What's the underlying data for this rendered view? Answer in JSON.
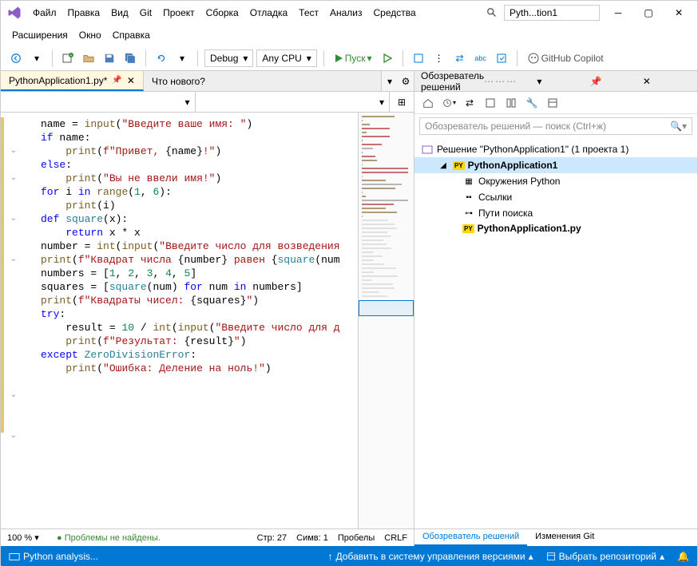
{
  "title_app": "Pyth...tion1",
  "menu": [
    "Файл",
    "Правка",
    "Вид",
    "Git",
    "Проект",
    "Сборка",
    "Отладка",
    "Тест",
    "Анализ",
    "Средства"
  ],
  "menu2": [
    "Расширения",
    "Окно",
    "Справка"
  ],
  "toolbar": {
    "config": "Debug",
    "platform": "Any CPU",
    "run": "Пуск",
    "copilot": "GitHub Copilot"
  },
  "tabs": {
    "active": "PythonApplication1.py*",
    "second": "Что нового?"
  },
  "code": [
    {
      "t": "name = ",
      "p": [
        [
          "fn",
          "input"
        ],
        [
          "op",
          "("
        ],
        [
          "str",
          "\"Введите ваше имя: \""
        ],
        [
          "op",
          ")"
        ]
      ]
    },
    {
      "t": ""
    },
    {
      "f": 1,
      "p": [
        [
          "kw",
          "if"
        ],
        [
          "op",
          " name:"
        ]
      ]
    },
    {
      "i": 1,
      "p": [
        [
          "fn",
          "print"
        ],
        [
          "op",
          "("
        ],
        [
          "str",
          "f\"Привет, "
        ],
        [
          "op",
          "{name}"
        ],
        [
          "str",
          "!\""
        ],
        [
          "op",
          ")"
        ]
      ]
    },
    {
      "f": 1,
      "p": [
        [
          "kw",
          "else"
        ],
        [
          "op",
          ":"
        ]
      ]
    },
    {
      "i": 1,
      "p": [
        [
          "fn",
          "print"
        ],
        [
          "op",
          "("
        ],
        [
          "str",
          "\"Вы не ввели имя!\""
        ],
        [
          "op",
          ")"
        ]
      ]
    },
    {
      "t": ""
    },
    {
      "f": 1,
      "p": [
        [
          "kw",
          "for"
        ],
        [
          "op",
          " i "
        ],
        [
          "kw",
          "in"
        ],
        [
          "op",
          " "
        ],
        [
          "fn",
          "range"
        ],
        [
          "op",
          "("
        ],
        [
          "num",
          "1"
        ],
        [
          "op",
          ", "
        ],
        [
          "num",
          "6"
        ],
        [
          "op",
          "):"
        ]
      ]
    },
    {
      "i": 1,
      "p": [
        [
          "fn",
          "print"
        ],
        [
          "op",
          "(i)"
        ]
      ]
    },
    {
      "t": ""
    },
    {
      "f": 1,
      "p": [
        [
          "kw",
          "def"
        ],
        [
          "op",
          " "
        ],
        [
          "fn2",
          "square"
        ],
        [
          "op",
          "(x):"
        ]
      ]
    },
    {
      "i": 1,
      "p": [
        [
          "kw",
          "return"
        ],
        [
          "op",
          " x * x"
        ]
      ]
    },
    {
      "t": ""
    },
    {
      "p": [
        [
          "op",
          "number = "
        ],
        [
          "fn",
          "int"
        ],
        [
          "op",
          "("
        ],
        [
          "fn",
          "input"
        ],
        [
          "op",
          "("
        ],
        [
          "str",
          "\"Введите число для возведения"
        ]
      ]
    },
    {
      "p": [
        [
          "fn",
          "print"
        ],
        [
          "op",
          "("
        ],
        [
          "str",
          "f\"Квадрат числа "
        ],
        [
          "op",
          "{number}"
        ],
        [
          "str",
          " равен "
        ],
        [
          "op",
          "{"
        ],
        [
          "fn2",
          "square"
        ],
        [
          "op",
          "(num"
        ]
      ]
    },
    {
      "t": ""
    },
    {
      "p": [
        [
          "op",
          "numbers = ["
        ],
        [
          "num",
          "1"
        ],
        [
          "op",
          ", "
        ],
        [
          "num",
          "2"
        ],
        [
          "op",
          ", "
        ],
        [
          "num",
          "3"
        ],
        [
          "op",
          ", "
        ],
        [
          "num",
          "4"
        ],
        [
          "op",
          ", "
        ],
        [
          "num",
          "5"
        ],
        [
          "op",
          "]"
        ]
      ]
    },
    {
      "p": [
        [
          "op",
          "squares = ["
        ],
        [
          "fn2",
          "square"
        ],
        [
          "op",
          "(num) "
        ],
        [
          "kw",
          "for"
        ],
        [
          "op",
          " num "
        ],
        [
          "kw",
          "in"
        ],
        [
          "op",
          " numbers]"
        ]
      ]
    },
    {
      "p": [
        [
          "fn",
          "print"
        ],
        [
          "op",
          "("
        ],
        [
          "str",
          "f\"Квадраты чисел: "
        ],
        [
          "op",
          "{squares}"
        ],
        [
          "str",
          "\""
        ],
        [
          "op",
          ")"
        ]
      ]
    },
    {
      "t": ""
    },
    {
      "f": 1,
      "p": [
        [
          "kw",
          "try"
        ],
        [
          "op",
          ":"
        ]
      ]
    },
    {
      "i": 1,
      "p": [
        [
          "op",
          "result = "
        ],
        [
          "num",
          "10"
        ],
        [
          "op",
          " / "
        ],
        [
          "fn",
          "int"
        ],
        [
          "op",
          "("
        ],
        [
          "fn",
          "input"
        ],
        [
          "op",
          "("
        ],
        [
          "str",
          "\"Введите число для д"
        ]
      ]
    },
    {
      "i": 1,
      "p": [
        [
          "fn",
          "print"
        ],
        [
          "op",
          "("
        ],
        [
          "str",
          "f\"Результат: "
        ],
        [
          "op",
          "{result}"
        ],
        [
          "str",
          "\""
        ],
        [
          "op",
          ")"
        ]
      ]
    },
    {
      "f": 1,
      "p": [
        [
          "kw",
          "except"
        ],
        [
          "op",
          " "
        ],
        [
          "cls",
          "ZeroDivisionError"
        ],
        [
          "op",
          ":"
        ]
      ]
    },
    {
      "i": 1,
      "p": [
        [
          "fn",
          "print"
        ],
        [
          "op",
          "("
        ],
        [
          "str",
          "\"Ошибка: Деление на ноль!\""
        ],
        [
          "op",
          ")"
        ]
      ]
    },
    {
      "t": ""
    }
  ],
  "status_editor": {
    "zoom": "100 %",
    "problems": "Проблемы не найдены.",
    "pos": "Стр: 27",
    "col": "Симв: 1",
    "ws": "Пробелы",
    "eol": "CRLF"
  },
  "se": {
    "title": "Обозреватель решений",
    "search_ph": "Обозреватель решений — поиск (Ctrl+ж)",
    "sln": "Решение \"PythonApplication1\"  (1 проекта 1)",
    "proj": "PythonApplication1",
    "env": "Окружения Python",
    "refs": "Ссылки",
    "paths": "Пути поиска",
    "file": "PythonApplication1.py",
    "tab1": "Обозреватель решений",
    "tab2": "Изменения Git"
  },
  "statusbar": {
    "py": "Python analysis...",
    "vcs": "Добавить в систему управления версиями",
    "repo": "Выбрать репозиторий"
  }
}
